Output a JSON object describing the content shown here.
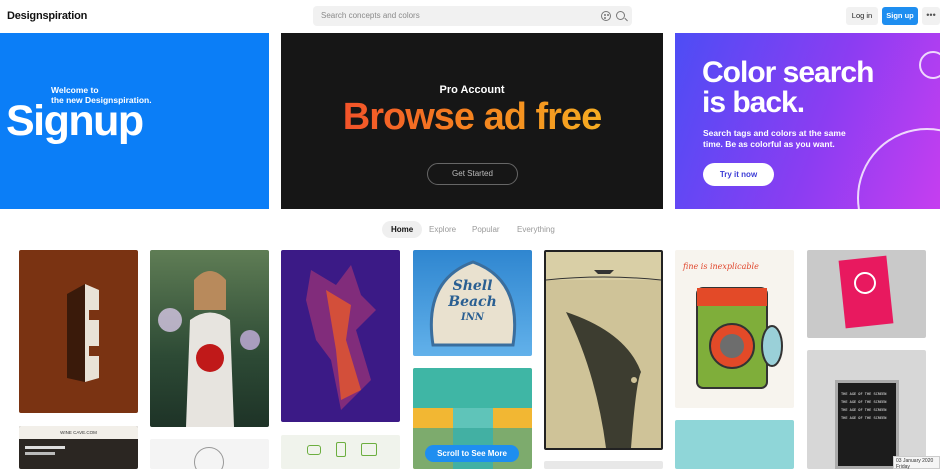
{
  "header": {
    "logo": "Designspiration",
    "search_placeholder": "Search concepts and colors",
    "login_label": "Log in",
    "signup_label": "Sign up",
    "more_label": "•••"
  },
  "banners": {
    "signup": {
      "small_line1": "Welcome to",
      "small_line2": "the new Designspiration.",
      "big": "Signup"
    },
    "pro": {
      "title": "Pro Account",
      "headline": "Browse ad free",
      "cta": "Get Started"
    },
    "color": {
      "headline_line1": "Color search",
      "headline_line2": "is back.",
      "sub": "Search tags and colors at the same time. Be as colorful as you want.",
      "cta": "Try it now"
    }
  },
  "tabs": [
    "Home",
    "Explore",
    "Popular",
    "Everything"
  ],
  "grid": {
    "scroll_label": "Scroll to See More",
    "shell_sign": [
      "Shell",
      "Beach",
      "INN"
    ],
    "washer_text": "fine is inexplicable",
    "site_title": "WINE CAVE.COM",
    "letterboard": [
      "THE AGE OF THE SCREEN",
      "THE AGE OF THE SCREEN",
      "THE AGE OF THE SCREEN",
      "THE AGE OF THE SCREEN"
    ]
  },
  "clock": {
    "date": "03 January 2020",
    "day": "Friday"
  },
  "colors": {
    "brand_blue": "#1e8ef0",
    "signup_banner": "#0b7ef7"
  }
}
